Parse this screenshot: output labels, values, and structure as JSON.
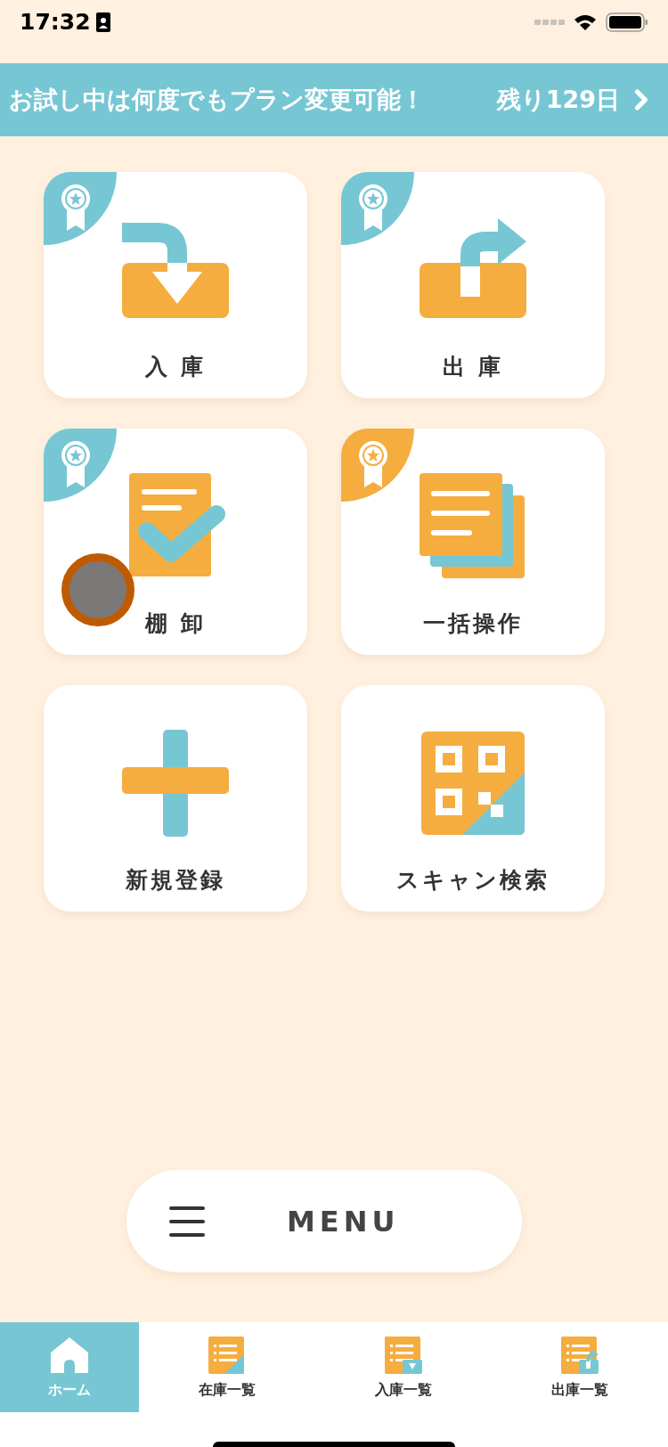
{
  "status_bar": {
    "time": "17:32"
  },
  "banner": {
    "message": "お試し中は何度でもプラン変更可能！",
    "remaining": "残り129日"
  },
  "tiles": [
    {
      "label": "入 庫",
      "kind": "in",
      "color": "#76c7d3"
    },
    {
      "label": "出 庫",
      "kind": "out",
      "color": "#76c7d3"
    },
    {
      "label": "棚 卸",
      "kind": "inventory",
      "color": "#76c7d3"
    },
    {
      "label": "一括操作",
      "kind": "bulk",
      "color": "#f5ad40"
    },
    {
      "label": "新規登録",
      "kind": "register"
    },
    {
      "label": "スキャン検索",
      "kind": "scan"
    }
  ],
  "menu": {
    "label": "MENU"
  },
  "tab_bar": [
    {
      "label": "ホーム",
      "kind": "home",
      "selected": true
    },
    {
      "label": "在庫一覧",
      "kind": "list",
      "selected": false
    },
    {
      "label": "入庫一覧",
      "kind": "in-list",
      "selected": false
    },
    {
      "label": "出庫一覧",
      "kind": "out-list",
      "selected": false
    }
  ]
}
